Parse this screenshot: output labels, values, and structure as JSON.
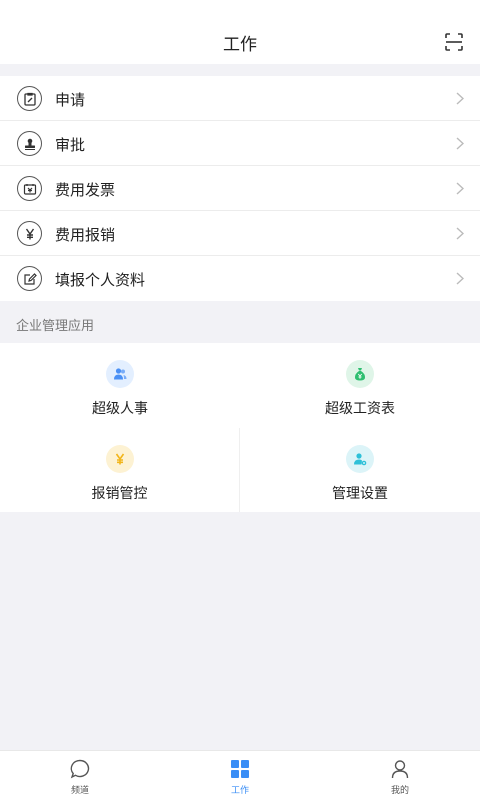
{
  "header": {
    "title": "工作",
    "scan_icon": "scan-icon"
  },
  "menu": [
    {
      "label": "申请",
      "icon": "clipboard-edit-icon"
    },
    {
      "label": "审批",
      "icon": "stamp-icon"
    },
    {
      "label": "费用发票",
      "icon": "invoice-icon"
    },
    {
      "label": "费用报销",
      "icon": "yen-icon"
    },
    {
      "label": "填报个人资料",
      "icon": "edit-note-icon"
    }
  ],
  "section_title": "企业管理应用",
  "apps": [
    {
      "label": "超级人事",
      "icon": "people-icon",
      "color": "#4a90f5",
      "bg": "#e3efff"
    },
    {
      "label": "超级工资表",
      "icon": "money-bag-icon",
      "color": "#2fbf71",
      "bg": "#dff5e8"
    },
    {
      "label": "报销管控",
      "icon": "yen-coin-icon",
      "color": "#f2b51a",
      "bg": "#fdf2d3"
    },
    {
      "label": "管理设置",
      "icon": "user-settings-icon",
      "color": "#2ec0d8",
      "bg": "#dcf4f8"
    }
  ],
  "tabbar": {
    "items": [
      {
        "label": "频道",
        "icon": "chat-bubble-icon"
      },
      {
        "label": "工作",
        "icon": "grid-icon",
        "active": true
      },
      {
        "label": "我的",
        "icon": "person-icon"
      }
    ],
    "active_color": "#3a8ef6"
  }
}
